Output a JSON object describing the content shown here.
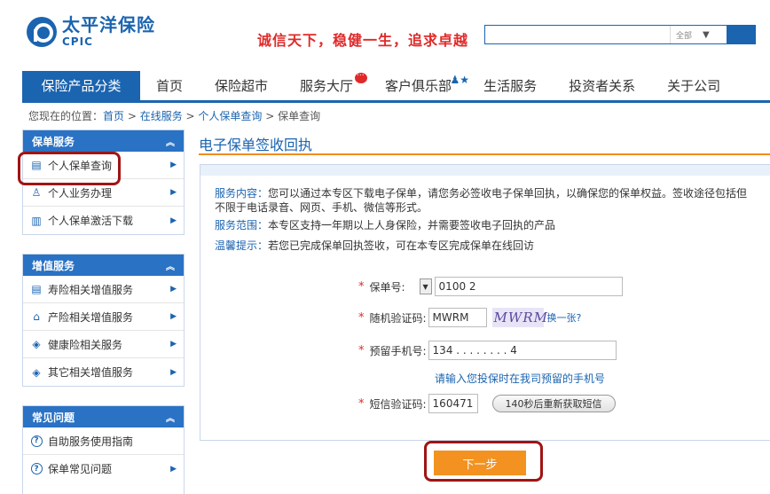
{
  "header": {
    "logo_cn": "太平洋保险",
    "logo_en": "CPIC",
    "slogan": "诚信天下，稳健一生，追求卓越",
    "search_placeholder": "",
    "search_scope": "全部"
  },
  "nav": {
    "items": [
      {
        "label": "保险产品分类"
      },
      {
        "label": "首页"
      },
      {
        "label": "保险超市"
      },
      {
        "label": "服务大厅"
      },
      {
        "label": "客户俱乐部"
      },
      {
        "label": "生活服务"
      },
      {
        "label": "投资者关系"
      },
      {
        "label": "关于公司"
      }
    ]
  },
  "breadcrumb": {
    "prefix": "您现在的位置：",
    "links": [
      "首页",
      "在线服务",
      "个人保单查询"
    ],
    "separator": " > ",
    "current": "保单查询"
  },
  "sidebar": {
    "panels": [
      {
        "title": "保单服务",
        "items": [
          {
            "label": "个人保单查询"
          },
          {
            "label": "个人业务办理"
          },
          {
            "label": "个人保单激活下载"
          }
        ]
      },
      {
        "title": "增值服务",
        "items": [
          {
            "label": "寿险相关增值服务"
          },
          {
            "label": "产险相关增值服务"
          },
          {
            "label": "健康险相关服务"
          },
          {
            "label": "其它相关增值服务"
          }
        ]
      },
      {
        "title": "常见问题",
        "items": [
          {
            "label": "自助服务使用指南"
          },
          {
            "label": "保单常见问题"
          }
        ]
      }
    ]
  },
  "main": {
    "title": "电子保单签收回执",
    "info": {
      "content_key": "服务内容：",
      "content_val": "您可以通过本专区下载电子保单，请您务必签收电子保单回执，以确保您的保单权益。签收途径包括但不限于电话录音、网页、手机、微信等形式。",
      "scope_key": "服务范围：",
      "scope_val": "本专区支持一年期以上人身保险，并需要签收电子回执的产品",
      "tip_key": "温馨提示：",
      "tip_val": "若您已完成保单回执签收，可在本专区完成保单在线回访"
    },
    "form": {
      "policy_label": "保单号:",
      "policy_value": "0100                    2",
      "captcha_label": "随机验证码:",
      "captcha_value": "MWRM",
      "captcha_image_text": "MWRM",
      "captcha_refresh": "换一张?",
      "phone_label": "预留手机号:",
      "phone_value": "134 . . . . . . . . 4",
      "phone_hint": "请输入您投保时在我司预留的手机号",
      "sms_label": "短信验证码:",
      "sms_value": "160471",
      "sms_button": "140秒后重新获取短信",
      "next_button": "下一步"
    }
  },
  "colors": {
    "brand": "#1b64b0",
    "accent_orange": "#f39221",
    "slogan_red": "#e02a2a",
    "highlight": "#a01414"
  }
}
